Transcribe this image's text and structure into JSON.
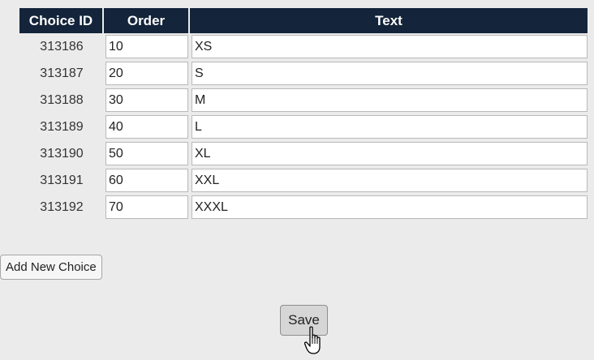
{
  "table": {
    "headers": {
      "choice_id": "Choice ID",
      "order": "Order",
      "text": "Text"
    },
    "rows": [
      {
        "id": "313186",
        "order": "10",
        "text": "XS"
      },
      {
        "id": "313187",
        "order": "20",
        "text": "S"
      },
      {
        "id": "313188",
        "order": "30",
        "text": "M"
      },
      {
        "id": "313189",
        "order": "40",
        "text": "L"
      },
      {
        "id": "313190",
        "order": "50",
        "text": "XL"
      },
      {
        "id": "313191",
        "order": "60",
        "text": "XXL"
      },
      {
        "id": "313192",
        "order": "70",
        "text": "XXXL"
      }
    ]
  },
  "actions": {
    "add_label": "Add New Choice",
    "save_label": "Save"
  },
  "cursor": {
    "icon": "hand-pointer-icon"
  },
  "colors": {
    "header_bg": "#14243a",
    "header_text": "#ffffff",
    "page_bg": "#ebebeb"
  }
}
